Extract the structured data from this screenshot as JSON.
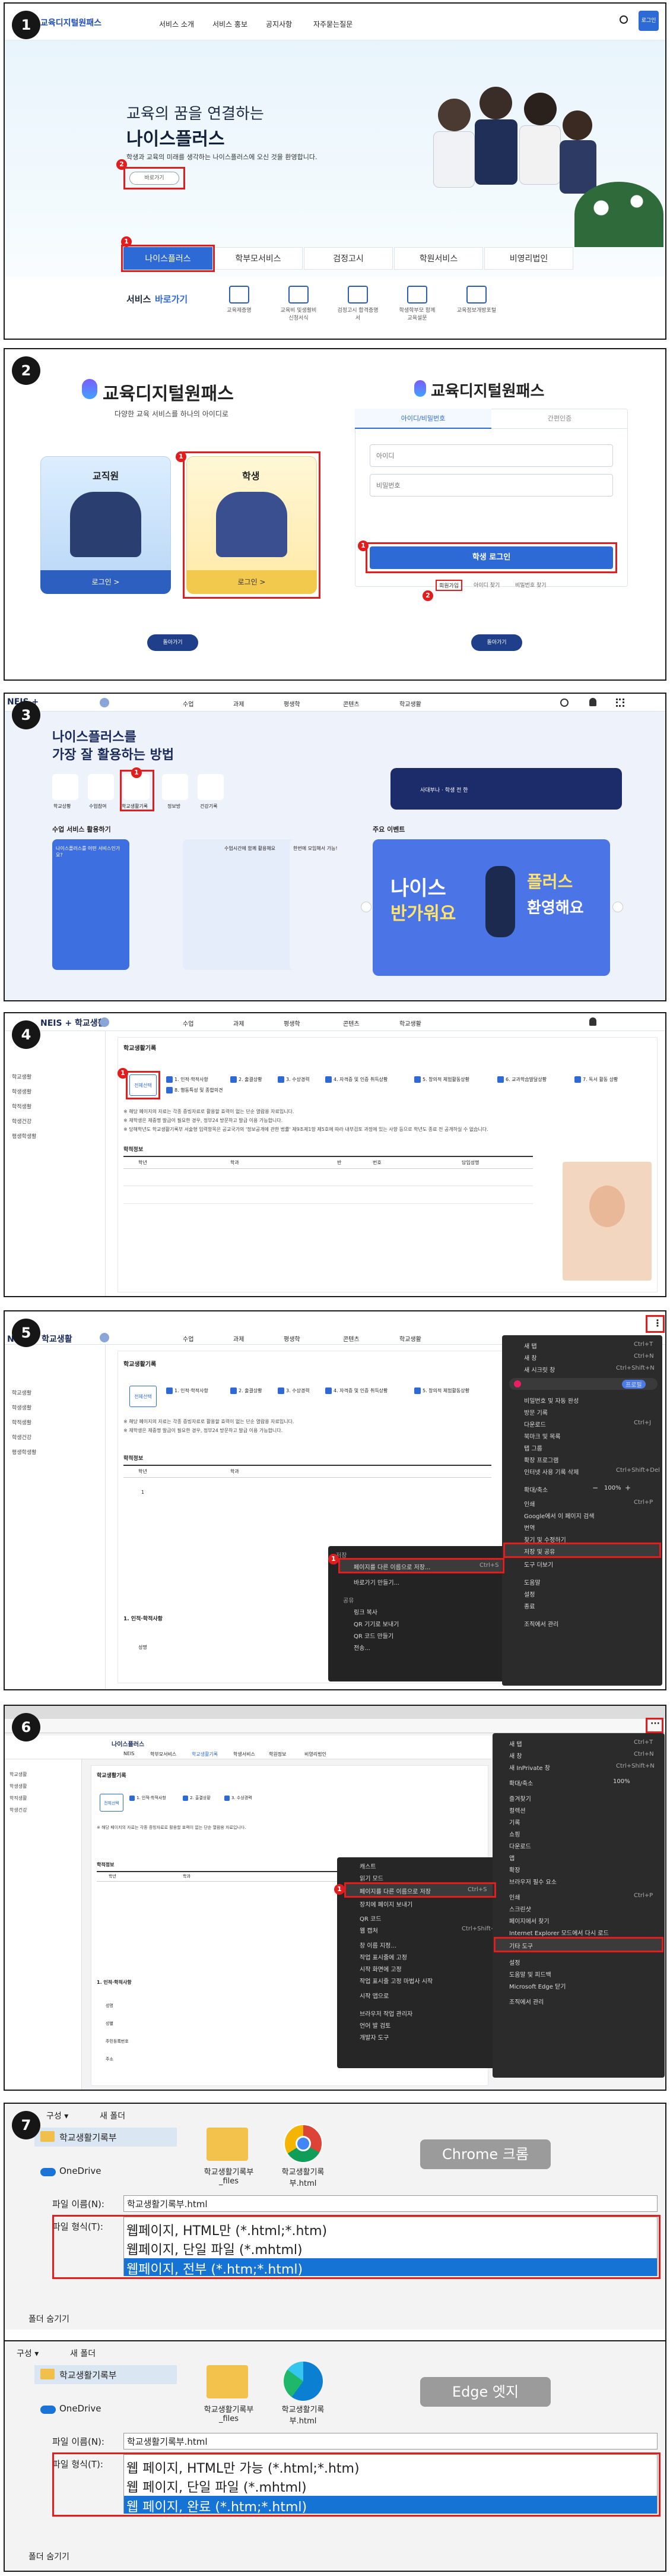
{
  "steps": {
    "s1": "1",
    "s2": "2",
    "s3": "3",
    "s4": "4",
    "s5": "5",
    "s6": "6",
    "s7": "7"
  },
  "marks": {
    "one": "1",
    "two": "2"
  },
  "panel1": {
    "logo": "교육디지털원패스",
    "nav": [
      "서비스 소개",
      "서비스 홍보",
      "공지사항",
      "자주묻는질문"
    ],
    "login": "로그인",
    "hero_line1": "교육의 꿈을 연결하는",
    "hero_line2": "나이스플러스",
    "hero_sub": "학생과 교육의 미래를 생각하는 나이스플러스에 오신 것을 환영합니다.",
    "hero_btn": "바로가기",
    "tabs": [
      "나이스플러스",
      "학부모서비스",
      "검정고시",
      "학원서비스",
      "비영리법인"
    ],
    "quick_title_a": "서비스",
    "quick_title_b": "바로가기",
    "quick_items": [
      "교육제증명",
      "교육비 및생활비 신청서식",
      "검정고시 합격증명서",
      "학생학부모 함께 교육설문",
      "교육정보개방포털"
    ]
  },
  "panel2": {
    "brand_left": "교육디지털원패스",
    "tagline": "다양한 교육 서비스를 하나의 아이디로",
    "staff": "교직원",
    "student": "학생",
    "login_btn": "로그인 >",
    "brand_right": "교육디지털원패스",
    "tab_id": "아이디/비밀번호",
    "tab_cert": "간편인증",
    "id_ph": "아이디",
    "pw_ph": "비밀번호",
    "student_login": "학생 로그인",
    "links": [
      "회원가입",
      "아이디 찾기",
      "비밀번호 찾기"
    ],
    "back": "돌아가기"
  },
  "panel3": {
    "logo": "NEIS +",
    "menu": [
      "수업",
      "과제",
      "평생학",
      "콘텐츠",
      "학교생활"
    ],
    "hero_a": "나이스플러스를",
    "hero_b": "가장 잘 활용하는 방법",
    "quick": [
      "학교상황",
      "수업참여",
      "학교생활기록",
      "정보방",
      "건강기록"
    ],
    "sec_a": "수업 서비스 활용하기",
    "sec_b": "주요 이벤트",
    "card1": "나이스플러스를 어떤 서비스인가요?",
    "card2": "수업시간에 함께 활용해요",
    "card3": "한번에 모임해서 가능!",
    "banner_a": "나이스",
    "banner_b": "플러스",
    "banner_c": "반가워요",
    "banner_d": "환영해요",
    "user": "사대부나 · 학생 전 한"
  },
  "panel4": {
    "logo": "NEIS + 학교생활",
    "menu": [
      "수업",
      "과제",
      "평생학",
      "콘텐츠",
      "학교생활"
    ],
    "side": [
      "학교생활",
      "학생생활",
      "학적생활",
      "학생건강",
      "평생학생활"
    ],
    "title": "학교생활기록",
    "all_check": "전체선택",
    "checks": [
      "1. 인적·학적사항",
      "2. 출결상황",
      "3. 수상경력",
      "4. 자격증 및 인증 취득상황",
      "5. 창의적 체험활동상황",
      "6. 교과학습발달상황",
      "7. 독서 활동 상황",
      "8. 행동특성 및 종합의견"
    ],
    "notes": [
      "※ 해당 페이지의 자료는 각종 증빙자료로 활용할 효력이 없는 단순 열람용 자료입니다.",
      "※ 재학생은 재중명 발급이 필요한 경우, 정부24 방문하고 발급 이용 가능합니다.",
      "※ 당해학년도 학교생활기록부 서술형 입력항목은 공교국가의 '정보공개에 관한 법률' 제9조제1항 제5호에 따라 내부검토 과정에 있는 사항 등으로 학년도 종료 전 공개하실 수 없습니다."
    ],
    "sec": "학적정보",
    "headers": [
      "학년",
      "학과",
      "반",
      "번호",
      "담임성명"
    ]
  },
  "panel5": {
    "menu_items": [
      "새 탭",
      "새 창",
      "새 시크릿 창",
      "",
      "비밀번호 및 자동 완성",
      "방문 기록",
      "다운로드",
      "북마크 및 목록",
      "탭 그룹",
      "확장 프로그램",
      "인터넷 사용 기록 삭제",
      "",
      "확대/축소",
      "인쇄",
      "Google에서 이 페이지 검색",
      "번역",
      "찾기 및 수정하기",
      "저장 및 공유",
      "도구 더보기",
      "",
      "도움말",
      "설정",
      "종료",
      "",
      "조직에서 관리"
    ],
    "shortcuts": [
      "Ctrl+T",
      "Ctrl+N",
      "Ctrl+Shift+N",
      "Ctrl+Shift+O",
      "Ctrl+H",
      "Ctrl+J",
      "",
      "",
      "",
      "",
      "Ctrl+Shift+Del",
      "",
      "100%",
      "Ctrl+P"
    ],
    "profile": "프로필",
    "zoom_minus": "−",
    "zoom_plus": "+",
    "submenu_title": "저장",
    "submenu": [
      "페이지를 다른 이름으로 저장...",
      "바로가기 만들기...",
      "",
      "공유",
      "링크 복사",
      "QR 기기로 보내기",
      "QR 코드 만들기",
      "전송..."
    ],
    "submenu_keys": [
      "Ctrl+S"
    ],
    "headers": [
      "학년",
      "학과",
      "반",
      "번호",
      "담임성명"
    ],
    "sec": "학적정보",
    "sec2": "1. 인적·학적사항",
    "row_label": "성명",
    "row_val": "1"
  },
  "panel6": {
    "title": "나이스플러스",
    "nav": [
      "NEIS",
      "학부모서비스",
      "학교생활기록",
      "학생서비스",
      "학원정보",
      "비영리법인"
    ],
    "menu_items": [
      "새 탭",
      "새 창",
      "새 InPrivate 창",
      "확대/축소",
      "즐겨찾기",
      "컬렉션",
      "기록",
      "쇼핑",
      "다운로드",
      "앱",
      "확장",
      "브라우저 필수 요소",
      "인쇄",
      "스크린샷",
      "페이지에서 찾기",
      "Internet Explorer 모드에서 다시 로드",
      "기타 도구",
      "설정",
      "도움말 및 피드백",
      "Microsoft Edge 닫기",
      "",
      "조직에서 관리"
    ],
    "shortcuts": [
      "Ctrl+T",
      "Ctrl+N",
      "Ctrl+Shift+N",
      "100%",
      "Ctrl+Shift+O",
      "Ctrl+Shift+Y",
      "Ctrl+H",
      "",
      "Ctrl+J",
      "",
      "",
      "",
      "Ctrl+P",
      "Ctrl+Shift+S",
      "Ctrl+F",
      "",
      "",
      "",
      "",
      "",
      ""
    ],
    "ctx_items": [
      "캐스트",
      "읽기 모드",
      "페이지를 다른 이름으로 저장",
      "장치에 페이지 보내기",
      "",
      "QR 코드",
      "웹 캡처",
      "",
      "창 이름 지정...",
      "작업 표시줄에 고정",
      "시작 화면에 고정",
      "작업 표시줄 고정 마법사 시작",
      "",
      "시작 앱으로",
      "",
      "브라우저 작업 관리자",
      "언어 발 검토",
      "개발자 도구"
    ],
    "ctx_keys": [
      "",
      "",
      "Ctrl+S",
      "",
      "",
      "",
      "Ctrl+Shift+S"
    ],
    "headers": [
      "학년",
      "학과",
      "반",
      "번호",
      "담임성명"
    ],
    "sec": "학적정보",
    "sec2": "1. 인적·학적사항",
    "rows": [
      "성명",
      "성별",
      "주민등록번호",
      "주소"
    ]
  },
  "panel7": {
    "chrome": {
      "back": "←",
      "organize": "구성 ▾",
      "newfolder": "새 폴더",
      "folder": "학교생활기록부",
      "onedrive": "OneDrive",
      "file_a": "학교생활기록부_files",
      "file_b": "학교생활기록부.html",
      "label": "Chrome 크롬",
      "fname_label": "파일 이름(N):",
      "fname": "학교생활기록부.html",
      "ftype_label": "파일 형식(T):",
      "types": [
        "웹페이지, HTML만 (*.html;*.htm)",
        "웹페이지, 단일 파일 (*.mhtml)",
        "웹페이지, 전부 (*.htm;*.html)"
      ],
      "hide": "폴더 숨기기"
    },
    "edge": {
      "organize": "구성 ▾",
      "newfolder": "새 폴더",
      "folder": "학교생활기록부",
      "onedrive": "OneDrive",
      "file_a": "학교생활기록부_files",
      "file_b": "학교생활기록부.html",
      "label": "Edge 엣지",
      "fname_label": "파일 이름(N):",
      "fname": "학교생활기록부.html",
      "ftype_label": "파일 형식(T):",
      "types": [
        "웹 페이지, HTML만 가능 (*.html;*.htm)",
        "웹 페이지, 단일 파일 (*.mhtml)",
        "웹 페이지, 완료 (*.htm;*.html)"
      ],
      "hide": "폴더 숨기기"
    }
  },
  "colors": {
    "red": "#e11d1d",
    "navy": "#1f3f8b",
    "blue": "#2d6ad6",
    "highlight": "#1673d6"
  }
}
